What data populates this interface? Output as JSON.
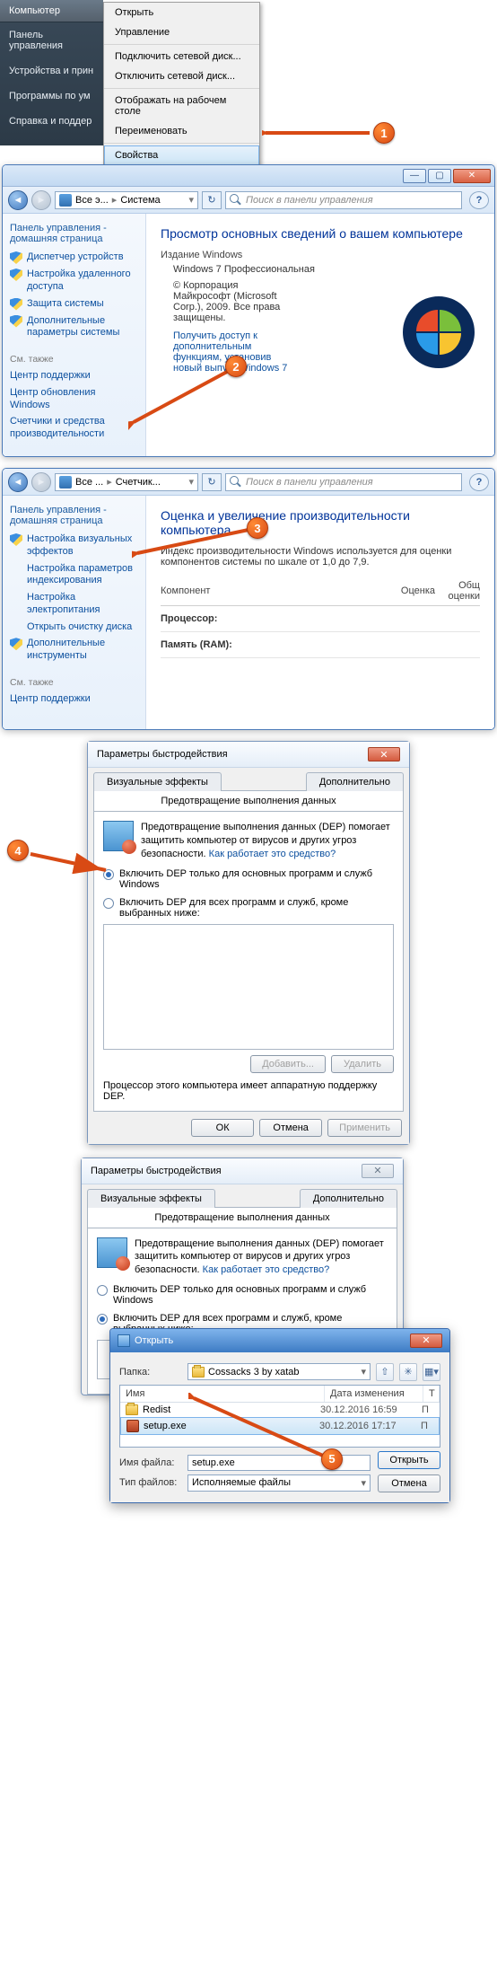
{
  "startmenu": {
    "highlighted": "Компьютер",
    "items": [
      "Панель управления",
      "Устройства и прин",
      "Программы по ум",
      "Справка и поддер"
    ]
  },
  "context": {
    "open": "Открыть",
    "manage": "Управление",
    "map": "Подключить сетевой диск...",
    "unmap": "Отключить сетевой диск...",
    "show_desktop": "Отображать на рабочем столе",
    "rename": "Переименовать",
    "properties": "Свойства"
  },
  "badges": {
    "b1": "1",
    "b2": "2",
    "b3": "3",
    "b4": "4",
    "b5": "5"
  },
  "sys_window": {
    "breadcrumb1": "Все э...",
    "breadcrumb2": "Система",
    "search_placeholder": "Поиск в панели управления",
    "sidebar_title": "Панель управления - домашняя страница",
    "side": {
      "dev_mgr": "Диспетчер устройств",
      "remote": "Настройка удаленного доступа",
      "protection": "Защита системы",
      "advanced": "Дополнительные параметры системы"
    },
    "see_also": "См. также",
    "sa": {
      "support": "Центр поддержки",
      "update": "Центр обновления Windows",
      "perf": "Счетчики и средства производительности"
    },
    "heading": "Просмотр основных сведений о вашем компьютере",
    "edition_label": "Издание Windows",
    "edition": "Windows 7 Профессиональная",
    "copyright": "© Корпорация Майкрософт (Microsoft Corp.), 2009. Все права защищены.",
    "more_features": "Получить доступ к дополнительным функциям, установив новый выпуск Windows 7"
  },
  "perf_window": {
    "breadcrumb1": "Все ...",
    "breadcrumb2": "Счетчик...",
    "search_placeholder": "Поиск в панели управления",
    "sidebar_title": "Панель управления - домашняя страница",
    "side": {
      "visual": "Настройка визуальных эффектов",
      "indexing": "Настройка параметров индексирования",
      "power": "Настройка электропитания",
      "cleanup": "Открыть очистку диска",
      "tools": "Дополнительные инструменты"
    },
    "see_also": "См. также",
    "sa": {
      "support": "Центр поддержки"
    },
    "heading": "Оценка и увеличение производительности компьютера",
    "desc": "Индекс производительности Windows используется для оценки компонентов системы по шкале от 1,0 до 7,9.",
    "col_component": "Компонент",
    "col_score": "Оценка",
    "col_overall": "Общ оценки",
    "row_cpu": "Процессор:",
    "row_ram": "Память (RAM):"
  },
  "dep_dialog": {
    "title": "Параметры быстродействия",
    "tab_visual": "Визуальные эффекты",
    "tab_adv": "Дополнительно",
    "tab_dep": "Предотвращение выполнения данных",
    "explain": "Предотвращение выполнения данных (DEP) помогает защитить компьютер от вирусов и других угроз безопасности.",
    "how_link": "Как работает это средство?",
    "opt1": "Включить DEP только для основных программ и служб Windows",
    "opt2": "Включить DEP для всех программ и служб, кроме выбранных ниже:",
    "add": "Добавить...",
    "del": "Удалить",
    "hw_note": "Процессор этого компьютера имеет аппаратную поддержку DEP.",
    "ok": "ОК",
    "cancel": "Отмена",
    "apply": "Применить"
  },
  "open_dialog": {
    "title": "Открыть",
    "folder_label": "Папка:",
    "folder": "Cossacks 3 by xatab",
    "col_name": "Имя",
    "col_date": "Дата изменения",
    "col_type": "Т",
    "rows": [
      {
        "name": "Redist",
        "date": "30.12.2016 16:59",
        "t": "П",
        "icon": "folder"
      },
      {
        "name": "setup.exe",
        "date": "30.12.2016 17:17",
        "t": "П",
        "icon": "exe",
        "selected": true
      }
    ],
    "file_label": "Имя файла:",
    "file_value": "setup.exe",
    "type_label": "Тип файлов:",
    "type_value": "Исполняемые файлы",
    "open_btn": "Открыть",
    "cancel_btn": "Отмена"
  }
}
